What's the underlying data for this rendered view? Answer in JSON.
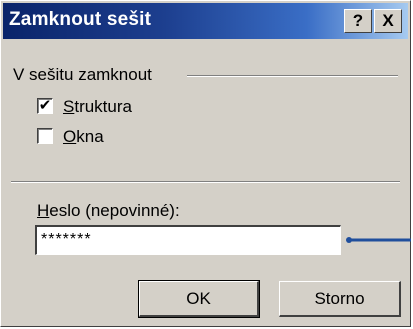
{
  "dialog": {
    "title": "Zamknout sešit",
    "help_label": "?",
    "close_label": "X"
  },
  "group": {
    "label": "V sešitu zamknout",
    "options": [
      {
        "first": "S",
        "rest": "truktura",
        "checked": true,
        "check_glyph": "✔"
      },
      {
        "first": "O",
        "rest": "kna",
        "checked": false,
        "check_glyph": ""
      }
    ]
  },
  "password": {
    "label_first": "H",
    "label_rest": "eslo (nepovinné):",
    "value": "*******"
  },
  "buttons": {
    "ok_label": "OK",
    "cancel_label": "Storno"
  },
  "colors": {
    "title_bar": "#0a246a",
    "face": "#d4d0c8",
    "pointer": "#1f4e9c"
  }
}
